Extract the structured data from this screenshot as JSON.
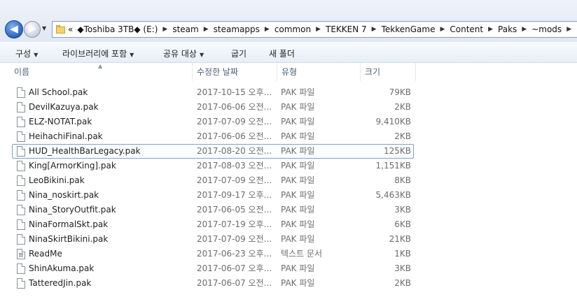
{
  "address_bar": {
    "breadcrumbs": [
      "◆Toshiba 3TB◆ (E:)",
      "steam",
      "steamapps",
      "common",
      "TEKKEN 7",
      "TekkenGame",
      "Content",
      "Paks",
      "~mods"
    ],
    "overflow_glyph": "«"
  },
  "toolbar": {
    "organize": "구성",
    "include_in_library": "라이브러리에 포함",
    "share_with": "공유 대상",
    "burn": "굽기",
    "new_folder": "새 폴더"
  },
  "columns": {
    "name": "이름",
    "date_modified": "수정한 날짜",
    "type": "유형",
    "size": "크기"
  },
  "files": [
    {
      "name": "All School.pak",
      "date": "2017-10-15 오후...",
      "type": "PAK 파일",
      "size": "79KB",
      "icon": "file-icon"
    },
    {
      "name": "DevilKazuya.pak",
      "date": "2017-06-06 오전...",
      "type": "PAK 파일",
      "size": "2KB",
      "icon": "file-icon"
    },
    {
      "name": "ELZ-NOTAT.pak",
      "date": "2017-07-09 오전...",
      "type": "PAK 파일",
      "size": "9,410KB",
      "icon": "file-icon"
    },
    {
      "name": "HeihachiFinal.pak",
      "date": "2017-06-06 오전...",
      "type": "PAK 파일",
      "size": "2KB",
      "icon": "file-icon"
    },
    {
      "name": "HUD_HealthBarLegacy.pak",
      "date": "2017-08-20 오전...",
      "type": "PAK 파일",
      "size": "125KB",
      "icon": "file-icon",
      "focused": true
    },
    {
      "name": "King[ArmorKing].pak",
      "date": "2017-08-03 오전...",
      "type": "PAK 파일",
      "size": "1,151KB",
      "icon": "file-icon"
    },
    {
      "name": "LeoBikini.pak",
      "date": "2017-07-09 오전...",
      "type": "PAK 파일",
      "size": "8KB",
      "icon": "file-icon"
    },
    {
      "name": "Nina_noskirt.pak",
      "date": "2017-09-17 오후...",
      "type": "PAK 파일",
      "size": "5,463KB",
      "icon": "file-icon"
    },
    {
      "name": "Nina_StoryOutfit.pak",
      "date": "2017-06-05 오전...",
      "type": "PAK 파일",
      "size": "3KB",
      "icon": "file-icon"
    },
    {
      "name": "NinaFormalSkt.pak",
      "date": "2017-07-19 오후...",
      "type": "PAK 파일",
      "size": "6KB",
      "icon": "file-icon"
    },
    {
      "name": "NinaSkirtBikini.pak",
      "date": "2017-07-09 오전...",
      "type": "PAK 파일",
      "size": "21KB",
      "icon": "file-icon"
    },
    {
      "name": "ReadMe",
      "date": "2017-06-23 오후...",
      "type": "텍스트 문서",
      "size": "1KB",
      "icon": "text-file-icon"
    },
    {
      "name": "ShinAkuma.pak",
      "date": "2017-06-07 오후...",
      "type": "PAK 파일",
      "size": "3KB",
      "icon": "file-icon"
    },
    {
      "name": "TatteredJin.pak",
      "date": "2017-06-07 오전...",
      "type": "PAK 파일",
      "size": "2KB",
      "icon": "file-icon"
    }
  ]
}
